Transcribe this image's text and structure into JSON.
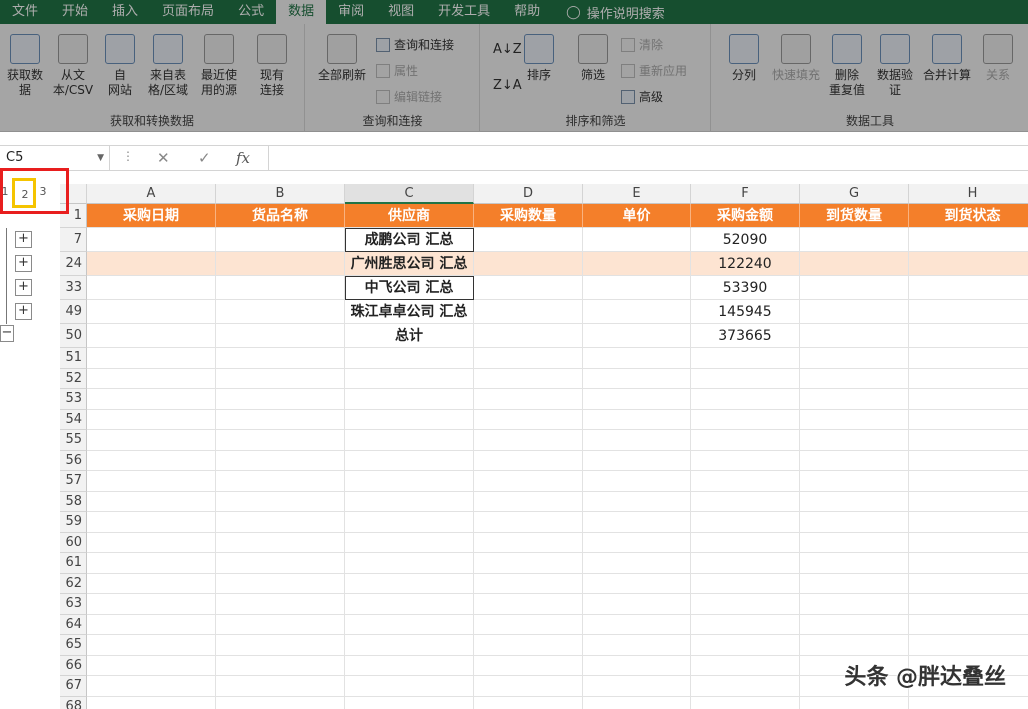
{
  "tabs": {
    "items": [
      "文件",
      "开始",
      "插入",
      "页面布局",
      "公式",
      "数据",
      "审阅",
      "视图",
      "开发工具",
      "帮助"
    ],
    "active": "数据",
    "tell_me": "操作说明搜索"
  },
  "ribbon": {
    "group1": {
      "label": "获取和转换数据",
      "get_data": "获取数\n据",
      "from_text": "从文\n本/CSV",
      "from_web": "自\n网站",
      "from_table": "来自表\n格/区域",
      "recent": "最近使\n用的源",
      "existing": "现有\n连接"
    },
    "group2": {
      "label": "查询和连接",
      "refresh_all": "全部刷新",
      "queries": "查询和连接",
      "properties": "属性",
      "edit_links": "编辑链接"
    },
    "group3": {
      "label": "排序和筛选",
      "sort": "排序",
      "filter": "筛选",
      "clear": "清除",
      "reapply": "重新应用",
      "advanced": "高级"
    },
    "group4": {
      "label": "数据工具",
      "text_to_columns": "分列",
      "flash_fill": "快速填充",
      "remove_dup": "删除\n重复值",
      "validation": "数据验\n证",
      "consolidate": "合并计算",
      "relations": "关系"
    }
  },
  "formula_bar": {
    "name_box": "C5",
    "fx": "fx"
  },
  "outline_levels": [
    "1",
    "2",
    "3"
  ],
  "columns": [
    "A",
    "B",
    "C",
    "D",
    "E",
    "F",
    "G",
    "H"
  ],
  "header_row": {
    "row_num": "1",
    "cells": [
      "采购日期",
      "货品名称",
      "供应商",
      "采购数量",
      "单价",
      "采购金额",
      "到货数量",
      "到货状态"
    ]
  },
  "data_rows": [
    {
      "row_num": "7",
      "supplier": "成鹏公司 汇总",
      "amount": "52090"
    },
    {
      "row_num": "24",
      "supplier": "广州胜思公司 汇总",
      "amount": "122240"
    },
    {
      "row_num": "33",
      "supplier": "中飞公司 汇总",
      "amount": "53390"
    },
    {
      "row_num": "49",
      "supplier": "珠江卓卓公司 汇总",
      "amount": "145945"
    },
    {
      "row_num": "50",
      "supplier": "总计",
      "amount": "373665"
    }
  ],
  "empty_rows": [
    "51",
    "52",
    "53",
    "54",
    "55",
    "56",
    "57",
    "58",
    "59",
    "60",
    "61",
    "62",
    "63",
    "64",
    "65",
    "66",
    "67",
    "68"
  ],
  "watermark": "头条 @胖达叠丝"
}
